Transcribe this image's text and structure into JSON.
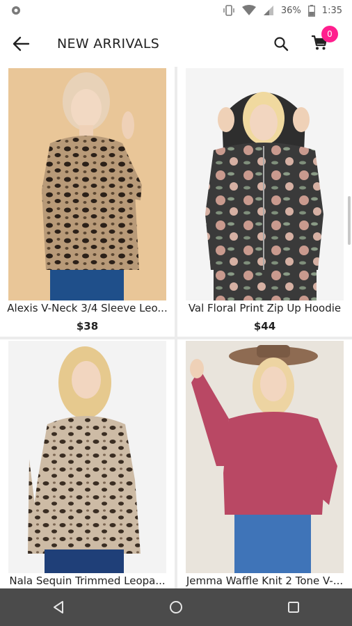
{
  "status": {
    "battery": "36%",
    "time": "1:35"
  },
  "header": {
    "title": "NEW ARRIVALS",
    "cart_count": "0"
  },
  "products": [
    {
      "name": "Alexis V-Neck 3/4 Sleeve Leo...",
      "price": "$38"
    },
    {
      "name": "Val Floral Print Zip Up Hoodie",
      "price": "$44"
    },
    {
      "name": "Nala Sequin Trimmed Leopa...",
      "price": ""
    },
    {
      "name": "Jemma Waffle Knit 2 Tone V-...",
      "price": ""
    }
  ],
  "colors": {
    "accent": "#ff1f8e",
    "navbar": "#4b4b4b"
  }
}
